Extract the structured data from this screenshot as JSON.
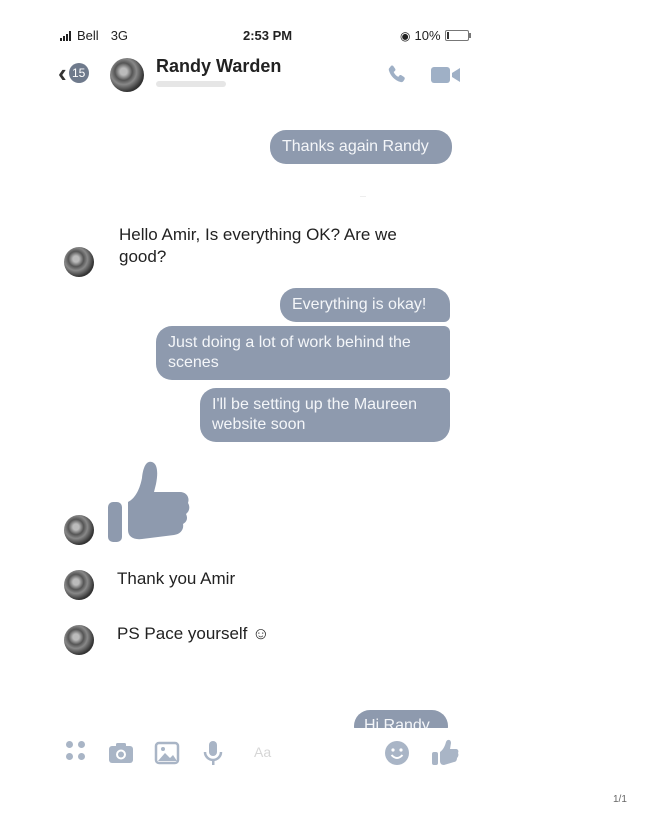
{
  "status_bar": {
    "carrier": "Bell",
    "network": "3G",
    "time": "2:53 PM",
    "battery_percent": "10%",
    "battery_level": 0.1
  },
  "header": {
    "back_badge": "15",
    "contact_name": "Randy Warden"
  },
  "messages": [
    {
      "side": "out",
      "text": "Thanks again Randy"
    },
    {
      "side": "in",
      "text": "Hello Amir, Is everything OK? Are we good?"
    },
    {
      "side": "out",
      "text": "Everything is okay!"
    },
    {
      "side": "out",
      "text": "Just doing a lot of work behind the scenes"
    },
    {
      "side": "out",
      "text": "I'll be setting up the Maureen website soon"
    },
    {
      "side": "in",
      "kind": "thumbs-up-sticker"
    },
    {
      "side": "in",
      "text": "Thank you Amir"
    },
    {
      "side": "in",
      "text": "PS Pace yourself ☺"
    },
    {
      "side": "out",
      "text": "Hi Randy"
    }
  ],
  "composer": {
    "placeholder": "Aa",
    "icons": [
      "apps-icon",
      "camera-icon",
      "image-icon",
      "microphone-icon",
      "emoji-icon",
      "thumbs-up-icon"
    ]
  },
  "page_number": "1/1",
  "colors": {
    "bubble_out": "#8e9aae",
    "icon_accent": "#9fb0c6"
  }
}
